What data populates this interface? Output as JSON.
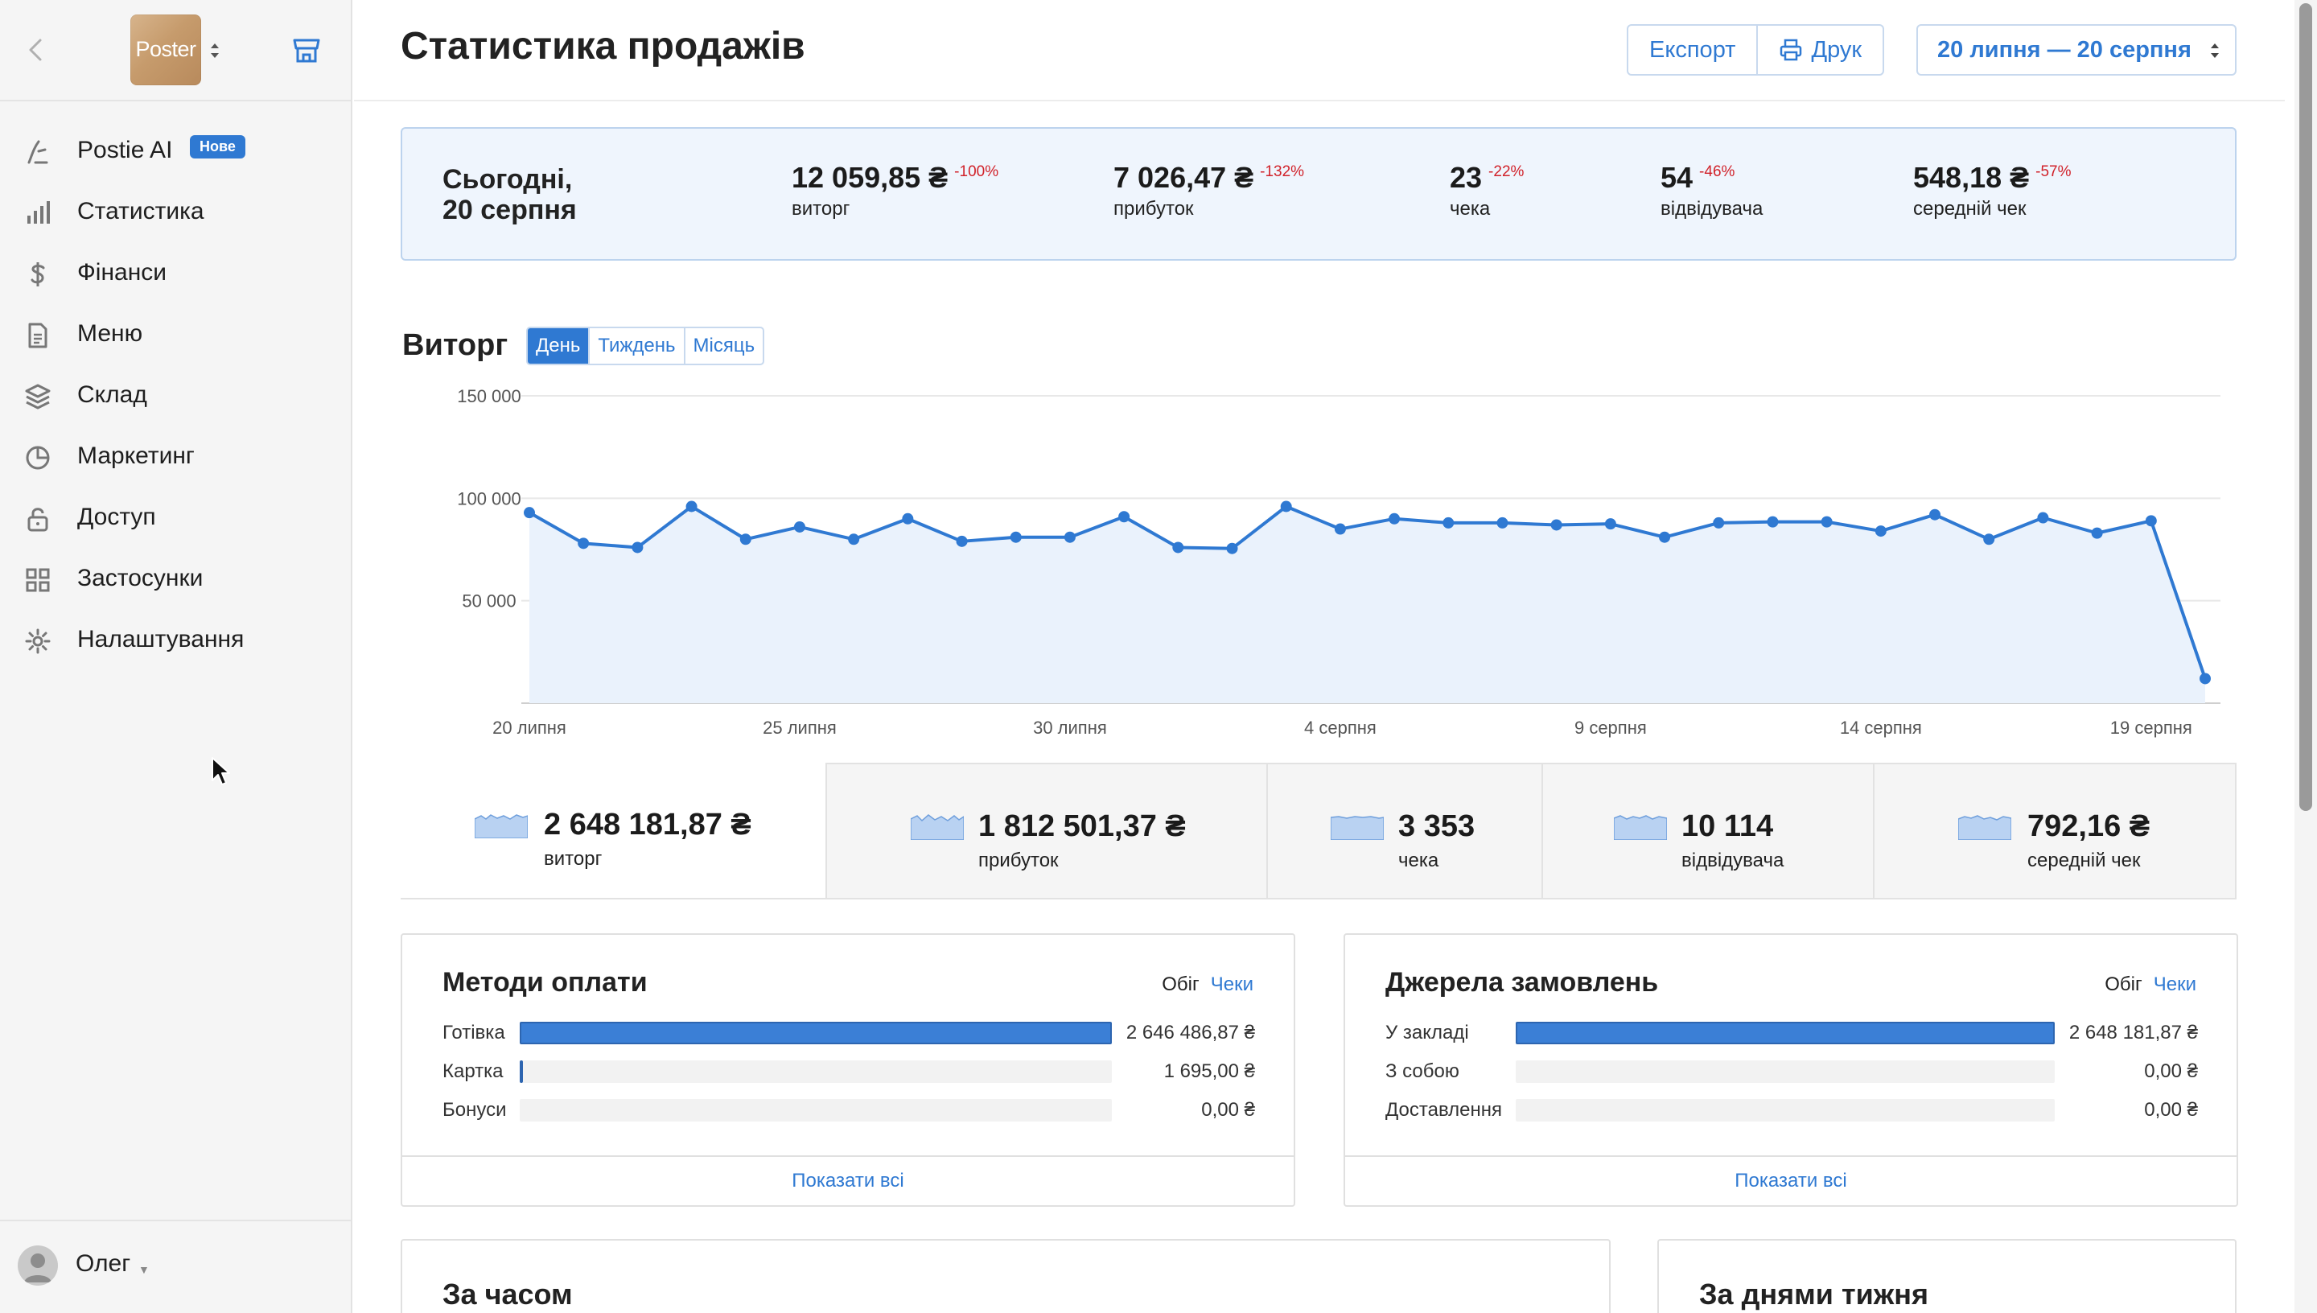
{
  "sidebar": {
    "logo_text": "Poster",
    "items": [
      {
        "label": "Postie AI",
        "badge": "Нове",
        "icon": "postie-ai-icon"
      },
      {
        "label": "Статистика",
        "icon": "bar-chart-icon"
      },
      {
        "label": "Фінанси",
        "icon": "dollar-icon"
      },
      {
        "label": "Меню",
        "icon": "document-icon"
      },
      {
        "label": "Склад",
        "icon": "layers-icon"
      },
      {
        "label": "Маркетинг",
        "icon": "pie-icon"
      },
      {
        "label": "Доступ",
        "icon": "lock-icon"
      },
      {
        "label": "Застосунки",
        "icon": "grid-icon"
      },
      {
        "label": "Налаштування",
        "icon": "gear-icon"
      }
    ],
    "user_name": "Олег"
  },
  "header": {
    "title": "Статистика продажів",
    "export_label": "Експорт",
    "print_label": "Друк",
    "date_range": "20 липня — 20 серпня"
  },
  "today": {
    "title_line1": "Сьогодні,",
    "title_line2": "20 серпня",
    "kpis": [
      {
        "value": "12 059,85 ₴",
        "delta": "-100%",
        "label": "виторг"
      },
      {
        "value": "7 026,47 ₴",
        "delta": "-132%",
        "label": "прибуток"
      },
      {
        "value": "23",
        "delta": "-22%",
        "label": "чека"
      },
      {
        "value": "54",
        "delta": "-46%",
        "label": "відвідувача"
      },
      {
        "value": "548,18 ₴",
        "delta": "-57%",
        "label": "середній чек"
      }
    ]
  },
  "revenue": {
    "title": "Виторг",
    "periods": [
      "День",
      "Тиждень",
      "Місяць"
    ],
    "active_period": "День"
  },
  "chart_data": {
    "type": "area",
    "title": "Виторг",
    "x": [
      "20 липня",
      "21 липня",
      "22 липня",
      "23 липня",
      "24 липня",
      "25 липня",
      "26 липня",
      "27 липня",
      "28 липня",
      "29 липня",
      "30 липня",
      "31 липня",
      "1 серпня",
      "2 серпня",
      "3 серпня",
      "4 серпня",
      "5 серпня",
      "6 серпня",
      "7 серпня",
      "8 серпня",
      "9 серпня",
      "10 серпня",
      "11 серпня",
      "12 серпня",
      "13 серпня",
      "14 серпня",
      "15 серпня",
      "16 серпня",
      "17 серпня",
      "18 серпня",
      "19 серпня",
      "20 серпня"
    ],
    "tick_labels": [
      "20 липня",
      "25 липня",
      "30 липня",
      "4 серпня",
      "9 серпня",
      "14 серпня",
      "19 серпня"
    ],
    "y_tick_labels": [
      "50 000",
      "100 000",
      "150 000"
    ],
    "series": [
      {
        "values": [
          93000,
          78000,
          76000,
          96000,
          80000,
          86000,
          80000,
          90000,
          79000,
          81000,
          81000,
          91000,
          76000,
          75500,
          96000,
          85000,
          90000,
          88000,
          88000,
          87000,
          87500,
          81000,
          88000,
          88500,
          88500,
          84000,
          92000,
          80000,
          90500,
          83000,
          89000,
          12000
        ]
      }
    ],
    "ylim": [
      0,
      150000
    ],
    "grid": true,
    "color": "#2f79d2",
    "fill": "#eaf2fc"
  },
  "totals": [
    {
      "value": "2 648 181,87 ₴",
      "label": "виторг"
    },
    {
      "value": "1 812 501,37 ₴",
      "label": "прибуток"
    },
    {
      "value": "3 353",
      "label": "чека"
    },
    {
      "value": "10 114",
      "label": "відвідувача"
    },
    {
      "value": "792,16 ₴",
      "label": "середній чек"
    }
  ],
  "payment_methods": {
    "title": "Методи оплати",
    "toggle_a": "Обіг",
    "toggle_b": "Чеки",
    "rows": [
      {
        "label": "Готівка",
        "value": "2 646 486,87 ₴",
        "share": 1.0
      },
      {
        "label": "Картка",
        "value": "1 695,00 ₴",
        "share": 0.0006
      },
      {
        "label": "Бонуси",
        "value": "0,00 ₴",
        "share": 0
      }
    ],
    "footer": "Показати всі"
  },
  "order_sources": {
    "title": "Джерела замовлень",
    "toggle_a": "Обіг",
    "toggle_b": "Чеки",
    "rows": [
      {
        "label": "У закладі",
        "value": "2 648 181,87 ₴",
        "share": 1.0
      },
      {
        "label": "З собою",
        "value": "0,00 ₴",
        "share": 0
      },
      {
        "label": "Доставлення",
        "value": "0,00 ₴",
        "share": 0
      }
    ],
    "footer": "Показати всі"
  },
  "by_time": {
    "title": "За часом"
  },
  "by_weekday": {
    "title": "За днями тижня"
  }
}
